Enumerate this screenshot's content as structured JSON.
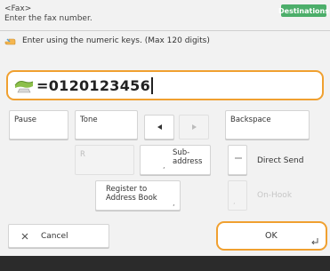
{
  "header": {
    "mode": "<Fax>",
    "instruction": "Enter the fax number.",
    "destinations_label": "Destinations"
  },
  "guide": {
    "text": "Enter using the numeric keys. (Max 120 digits)",
    "icon": "hand-pointer-icon"
  },
  "fax_input": {
    "icon": "phone-handset-icon",
    "value": "=0120123456"
  },
  "keys": {
    "pause": "Pause",
    "tone": "Tone",
    "cursor_left": "left-arrow-icon",
    "cursor_right": "right-arrow-icon",
    "backspace": "Backspace",
    "subaddress_line1": "Sub-",
    "subaddress_line2": "address",
    "r_key": "R",
    "direct_send": "Direct Send",
    "register_line1": "Register to",
    "register_line2": "Address Book",
    "on_hook": "On-Hook"
  },
  "actions": {
    "cancel": "Cancel",
    "ok": "OK"
  },
  "colors": {
    "accent_green": "#4cae6a",
    "focus_orange": "#f0a030",
    "bottom_bar": "#2b2b2b"
  }
}
